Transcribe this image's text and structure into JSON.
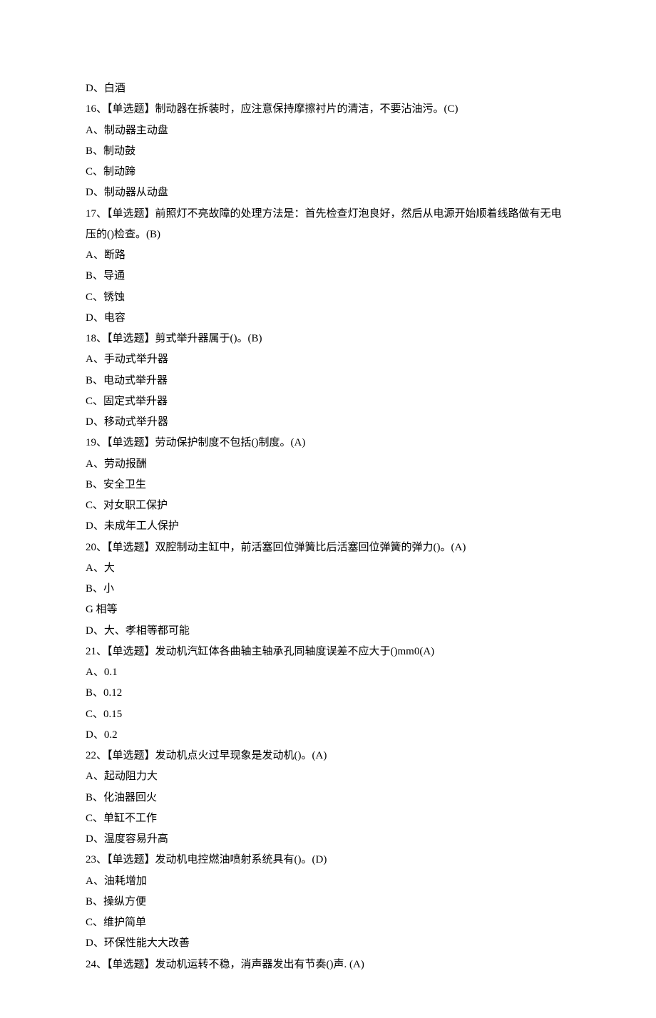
{
  "lines": [
    "D、白酒",
    "16、【单选题】制动器在拆装时，应注意保持摩擦衬片的清洁，不要沾油污。(C)",
    "A、制动器主动盘",
    "B、制动鼓",
    "C、制动蹄",
    "D、制动器从动盘",
    "17、【单选题】前照灯不亮故障的处理方法是：首先检查灯泡良好，然后从电源开始顺着线路做有无电压的()检查。(B)",
    "A、断路",
    "B、导通",
    "C、锈蚀",
    "D、电容",
    "18、【单选题】剪式举升器属于()。(B)",
    "A、手动式举升器",
    "B、电动式举升器",
    "C、固定式举升器",
    "D、移动式举升器",
    "19、【单选题】劳动保护制度不包括()制度。(A)",
    "A、劳动报酬",
    "B、安全卫生",
    "C、对女职工保护",
    "D、未成年工人保护",
    "20、【单选题】双腔制动主缸中，前活塞回位弹簧比后活塞回位弹簧的弹力()。(A)",
    "A、大",
    "B、小",
    "G 相等",
    "D、大、孝相等都可能",
    "21、【单选题】发动机汽缸体各曲轴主轴承孔同轴度误差不应大于()mm0(A)",
    "A、0.1",
    "B、0.12",
    "C、0.15",
    "D、0.2",
    "22、【单选题】发动机点火过早现象是发动机()。(A)",
    "A、起动阻力大",
    "B、化油器回火",
    "C、单缸不工作",
    "D、温度容易升高",
    "23、【单选题】发动机电控燃油喷射系统具有()。(D)",
    "A、油耗增加",
    "B、操纵方便",
    "C、维护简单",
    "D、环保性能大大改善",
    "24、【单选题】发动机运转不稳，消声器发出有节奏()声. (A)"
  ]
}
